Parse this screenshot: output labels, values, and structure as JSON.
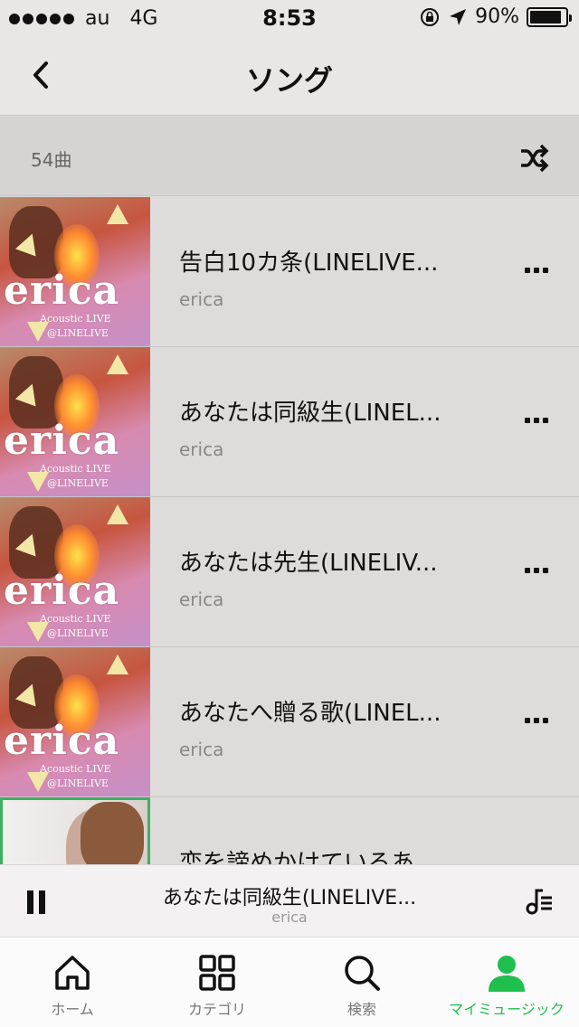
{
  "status_bar": {
    "carrier": "au",
    "network": "4G",
    "time": "8:53",
    "battery": "90%",
    "battery_level": 0.9
  },
  "nav": {
    "title": "ソング"
  },
  "list_header": {
    "count": "54曲"
  },
  "songs": [
    {
      "title": "告白10カ条(LINELIVE...",
      "artist": "erica",
      "art": "erica"
    },
    {
      "title": "あなたは同級生(LINEL...",
      "artist": "erica",
      "art": "erica"
    },
    {
      "title": "あなたは先生(LINELIV...",
      "artist": "erica",
      "art": "erica"
    },
    {
      "title": "あなたへ贈る歌(LINEL...",
      "artist": "erica",
      "art": "erica"
    },
    {
      "title": "恋を諦めかけているあ…",
      "artist": "",
      "art": "photo"
    }
  ],
  "album_art": {
    "name": "erica",
    "line1": "Acoustic LIVE",
    "line2": "@LINELIVE"
  },
  "player": {
    "title": "あなたは同級生(LINELIVE...",
    "artist": "erica"
  },
  "tabs": [
    {
      "label": "ホーム",
      "icon": "home-icon",
      "active": false
    },
    {
      "label": "カテゴリ",
      "icon": "grid-icon",
      "active": false
    },
    {
      "label": "検索",
      "icon": "search-icon",
      "active": false
    },
    {
      "label": "マイミュージック",
      "icon": "person-icon",
      "active": true
    }
  ],
  "colors": {
    "accent": "#1fbf4e",
    "now_playing_border": "#3cb064"
  }
}
